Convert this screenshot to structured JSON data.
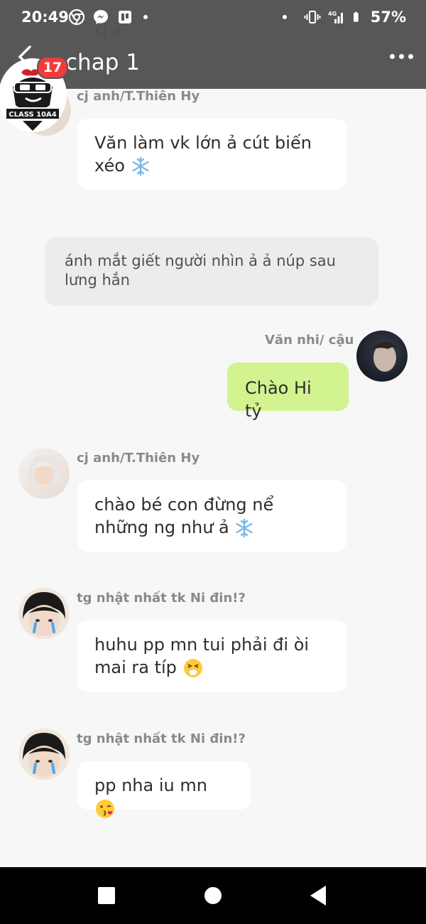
{
  "status_bar": {
    "time": "20:49",
    "battery": "57%",
    "left_icons": [
      "chrome-icon",
      "messenger-icon",
      "pages-icon"
    ],
    "right_icons": [
      "vibrate-icon",
      "signal-4g-icon",
      "battery-icon"
    ]
  },
  "header": {
    "title": "chap 1",
    "ghost_preview": "cj ạ",
    "badge_count": "17",
    "group_logo_text": "CLASS 10A4"
  },
  "narration": {
    "text": "ánh mắt giết người nhìn ả ả núp sau lưng hắn"
  },
  "messages": [
    {
      "sender": "cj anh/T.Thiên Hy",
      "text": "Văn làm vk lớn ả cút biến xéo",
      "emoji": "snowflake",
      "side": "left"
    },
    {
      "sender": "Văn nhi/ cậu",
      "text": "Chào Hi tỷ",
      "emoji": "",
      "side": "right"
    },
    {
      "sender": "cj anh/T.Thiên Hy",
      "text": "chào bé con đừng nể những ng như ả",
      "emoji": "snowflake",
      "side": "left"
    },
    {
      "sender": "tg nhật nhất tk Ni đin!?",
      "text": "huhu pp mn tui phải đi òi mai ra típ",
      "emoji": "sneezing-face",
      "side": "left"
    },
    {
      "sender": "tg nhật nhất tk Ni đin!?",
      "text": "pp nha iu mn",
      "emoji": "kissing-face",
      "side": "left"
    }
  ],
  "nav": {
    "buttons": [
      "recents-button",
      "home-button",
      "back-button"
    ]
  },
  "colors": {
    "header_bg": "#575757",
    "chat_bg": "#f7f7f7",
    "my_bubble": "#d3f290",
    "other_bubble": "#ffffff",
    "narration_bg": "#ececec",
    "badge": "#f23b3b"
  }
}
